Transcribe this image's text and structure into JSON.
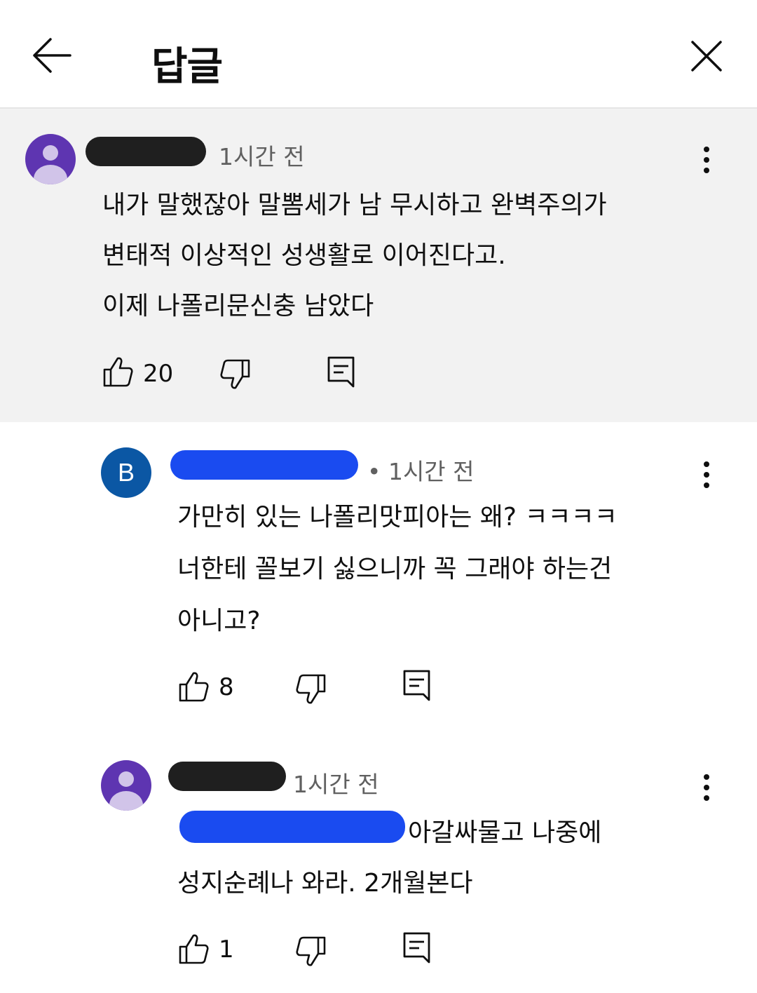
{
  "header": {
    "title": "답글"
  },
  "comments": [
    {
      "avatar": "person-icon",
      "author_redacted": true,
      "time": "1시간 전",
      "lines": [
        "내가 말했잖아 말뽐세가 남 무시하고 완벽주의가",
        "변태적 이상적인 성생활로 이어진다고.",
        "이제 나폴리문신충 남았다"
      ],
      "likes": "20"
    },
    {
      "avatar": "B",
      "author_redacted": true,
      "time": "• 1시간 전",
      "lines": [
        "가만히 있는 나폴리맛피아는 왜? ㅋㅋㅋㅋ",
        "너한테 꼴보기 싫으니까 꼭 그래야 하는건",
        "아니고?"
      ],
      "likes": "8"
    },
    {
      "avatar": "person-icon",
      "author_redacted": true,
      "time": "1시간 전",
      "lines": [
        "아갈싸물고 나중에",
        "성지순례나 와라. 2개월본다"
      ],
      "likes": "1"
    }
  ],
  "colors": {
    "highlight_bg": "#f2f2f2",
    "avatar_purple": "#5e35b1",
    "avatar_blue": "#0b57a4",
    "redact_black": "#1f1f1f",
    "redact_blue": "#1a4bf0"
  }
}
